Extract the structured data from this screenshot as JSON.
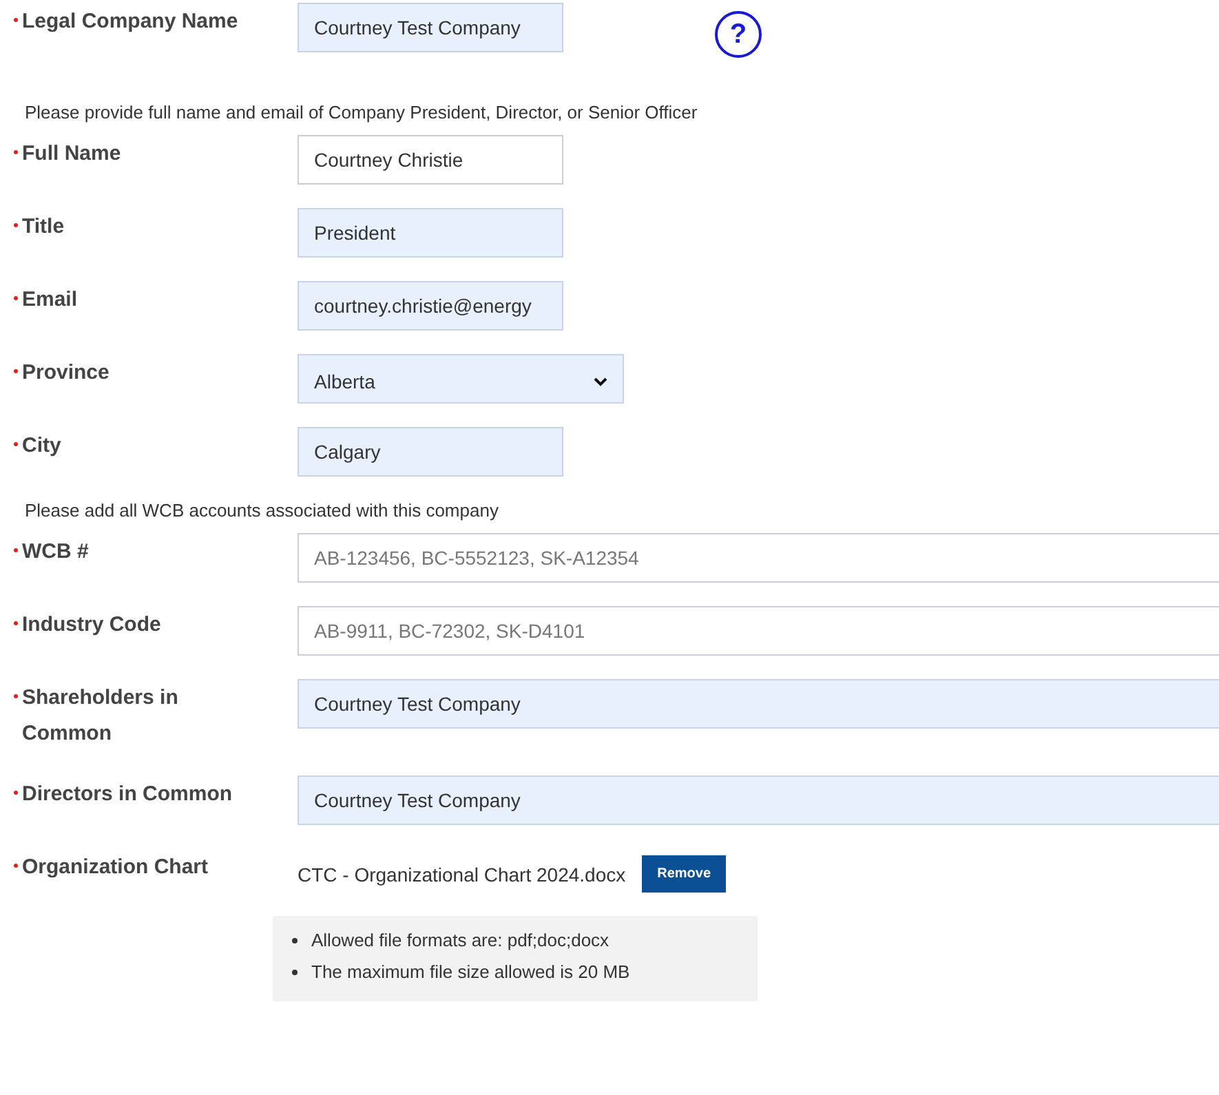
{
  "help_button": {
    "label": "?"
  },
  "items": [
    {
      "kind": "text",
      "label": "Legal Company Name",
      "required": true,
      "value": "Courtney Test Company",
      "filled": true,
      "full_width": false,
      "help": true
    },
    {
      "kind": "note",
      "text": "Please provide full name and email of Company President, Director, or Senior Officer"
    },
    {
      "kind": "text",
      "label": "Full Name",
      "required": true,
      "value": "Courtney Christie",
      "filled": false,
      "full_width": false
    },
    {
      "kind": "text",
      "label": "Title",
      "required": true,
      "value": "President",
      "filled": true,
      "full_width": false
    },
    {
      "kind": "text",
      "label": "Email",
      "required": true,
      "value": "courtney.christie@energy",
      "filled": true,
      "full_width": false
    },
    {
      "kind": "select",
      "label": "Province",
      "required": true,
      "value": "Alberta",
      "filled": true,
      "full_width": false
    },
    {
      "kind": "text",
      "label": "City",
      "required": true,
      "value": "Calgary",
      "filled": true,
      "full_width": false
    },
    {
      "kind": "note",
      "text": "Please add all WCB accounts associated with this company"
    },
    {
      "kind": "text",
      "label": "WCB #",
      "required": true,
      "placeholder": "AB-123456, BC-5552123, SK-A12354",
      "filled": false,
      "full_width": true
    },
    {
      "kind": "text",
      "label": "Industry Code",
      "required": true,
      "placeholder": "AB-9911, BC-72302, SK-D4101",
      "filled": false,
      "full_width": true
    },
    {
      "kind": "text",
      "label": "Shareholders in Common",
      "required": true,
      "value": "Courtney Test Company",
      "filled": true,
      "full_width": true
    },
    {
      "kind": "text",
      "label": "Directors in Common",
      "required": true,
      "value": "Courtney Test Company",
      "filled": true,
      "full_width": true
    },
    {
      "kind": "file",
      "label": "Organization Chart",
      "required": true,
      "file_name": "CTC - Organizational Chart 2024.docx",
      "button": "Remove"
    }
  ],
  "file_rules": [
    "Allowed file formats are: pdf;doc;docx",
    "The maximum file size allowed is 20 MB"
  ]
}
